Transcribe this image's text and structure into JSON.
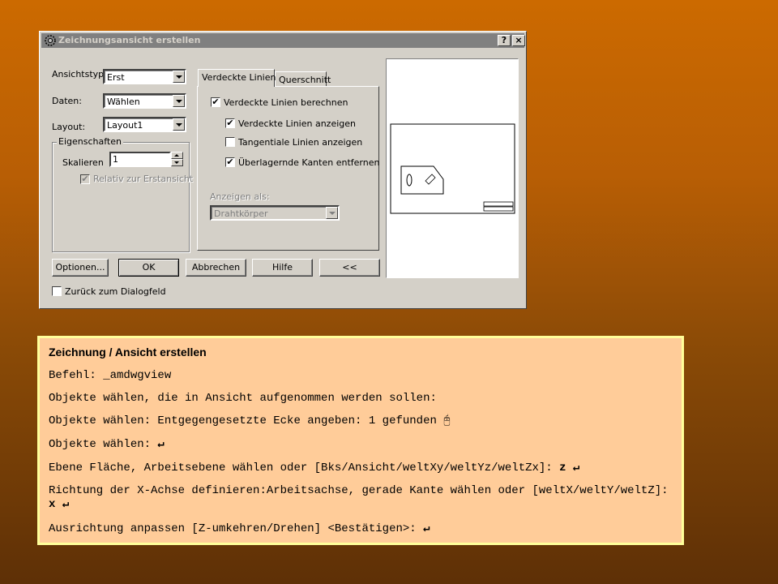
{
  "dialog": {
    "title": "Zeichnungsansicht erstellen",
    "help_button": "?",
    "close_button": "×",
    "view_type_label": "Ansichtstyp:",
    "view_type_value": "Erst",
    "data_label": "Daten:",
    "data_value": "Wählen",
    "layout_label": "Layout:",
    "layout_value": "Layout1",
    "properties_group": "Eigenschaften",
    "scale_label": "Skalieren",
    "scale_value": "1",
    "relative_label": "Relativ zur Erstansicht",
    "tabs": [
      {
        "label": "Verdeckte Linien",
        "active": true
      },
      {
        "label": "Querschnitt",
        "active": false
      }
    ],
    "checkboxes": [
      {
        "label": "Verdeckte Linien berechnen",
        "checked": true
      },
      {
        "label": "Verdeckte Linien anzeigen",
        "checked": true
      },
      {
        "label": "Tangentiale Linien anzeigen",
        "checked": false
      },
      {
        "label": "Überlagernde Kanten entfernen",
        "checked": true
      }
    ],
    "display_as_label": "Anzeigen als:",
    "display_as_value": "Drahtkörper",
    "buttons": {
      "options": "Optionen...",
      "ok": "OK",
      "cancel": "Abbrechen",
      "help": "Hilfe",
      "collapse": "<<"
    },
    "return_label": "Zurück zum Dialogfeld"
  },
  "panel": {
    "title": "Zeichnung / Ansicht erstellen",
    "lines": [
      {
        "text": "Befehl: _amdwgview",
        "bold": ""
      },
      {
        "text": "Objekte wählen, die in Ansicht aufgenommen werden sollen:",
        "bold": ""
      },
      {
        "text": "Objekte wählen: Entgegengesetzte Ecke angeben: 1 gefunden ",
        "bold": ""
      },
      {
        "text": "Objekte wählen: ",
        "bold": ""
      },
      {
        "text": "Ebene Fläche, Arbeitsebene wählen oder [Bks/Ansicht/weltXy/weltYz/weltZx]: ",
        "bold": "z"
      },
      {
        "text": "Richtung der X-Achse definieren:Arbeitsachse, gerade Kante wählen oder [weltX/weltY/weltZ]: ",
        "bold": "x"
      },
      {
        "text": "Ausrichtung anpassen [Z-umkehren/Drehen] <Bestätigen>: ",
        "bold": ""
      }
    ],
    "enter_symbol": "↵"
  }
}
